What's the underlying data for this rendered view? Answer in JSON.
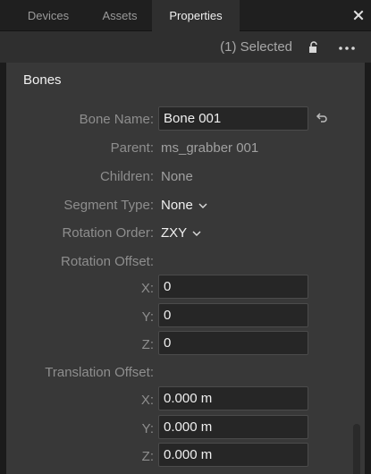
{
  "tabs": [
    {
      "label": "Devices"
    },
    {
      "label": "Assets"
    },
    {
      "label": "Properties"
    }
  ],
  "selection": {
    "text": "(1) Selected"
  },
  "section": {
    "title": "Bones"
  },
  "fields": {
    "bone_name": {
      "label": "Bone Name:",
      "value": "Bone 001"
    },
    "parent": {
      "label": "Parent:",
      "value": "ms_grabber 001"
    },
    "children": {
      "label": "Children:",
      "value": "None"
    },
    "segment_type": {
      "label": "Segment Type:",
      "value": "None"
    },
    "rotation_order": {
      "label": "Rotation Order:",
      "value": "ZXY"
    },
    "rotation_offset": {
      "label": "Rotation Offset:",
      "x": {
        "label": "X:",
        "value": "0"
      },
      "y": {
        "label": "Y:",
        "value": "0"
      },
      "z": {
        "label": "Z:",
        "value": "0"
      }
    },
    "translation_offset": {
      "label": "Translation Offset:",
      "x": {
        "label": "X:",
        "value": "0.000 m"
      },
      "y": {
        "label": "Y:",
        "value": "0.000 m"
      },
      "z": {
        "label": "Z:",
        "value": "0.000 m"
      }
    }
  },
  "icons": {
    "close": "close-icon",
    "lock": "lock-icon",
    "more": "more-icon",
    "undo": "undo-icon",
    "chevron": "chevron-down-icon"
  },
  "colors": {
    "background": "#1b1b1b",
    "panel": "#383838",
    "field": "#262626",
    "label": "#8e8e8e",
    "text": "#efefef"
  }
}
